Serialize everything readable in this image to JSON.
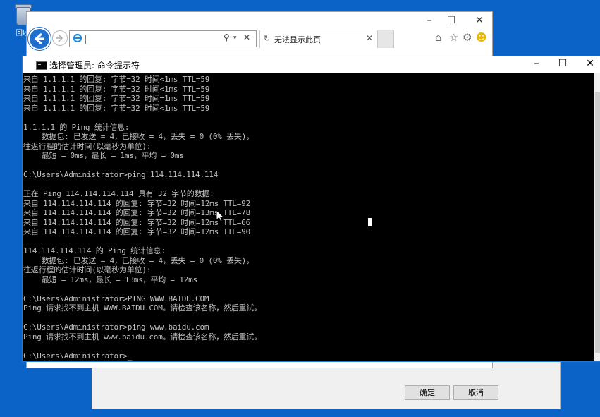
{
  "desktop": {
    "icon_label": "回收"
  },
  "dialog": {
    "ok_label": "确定",
    "cancel_label": "取消"
  },
  "browser": {
    "address_value": "|",
    "tab_title": "无法显示此页"
  },
  "cmd": {
    "title": "选择管理员: 命令提示符",
    "lines": [
      "来自 1.1.1.1 的回复: 字节=32 时间<1ms TTL=59",
      "来自 1.1.1.1 的回复: 字节=32 时间<1ms TTL=59",
      "来自 1.1.1.1 的回复: 字节=32 时间=1ms TTL=59",
      "来自 1.1.1.1 的回复: 字节=32 时间<1ms TTL=59",
      "",
      "1.1.1.1 的 Ping 统计信息:",
      "    数据包: 已发送 = 4，已接收 = 4，丢失 = 0 (0% 丢失)，",
      "往返行程的估计时间(以毫秒为单位):",
      "    最短 = 0ms，最长 = 1ms，平均 = 0ms",
      "",
      "C:\\Users\\Administrator>ping 114.114.114.114",
      "",
      "正在 Ping 114.114.114.114 具有 32 字节的数据:",
      "来自 114.114.114.114 的回复: 字节=32 时间=12ms TTL=92",
      "来自 114.114.114.114 的回复: 字节=32 时间=13ms TTL=78",
      "来自 114.114.114.114 的回复: 字节=32 时间=12ms TTL=66",
      "来自 114.114.114.114 的回复: 字节=32 时间=12ms TTL=90",
      "",
      "114.114.114.114 的 Ping 统计信息:",
      "    数据包: 已发送 = 4，已接收 = 4，丢失 = 0 (0% 丢失)，",
      "往返行程的估计时间(以毫秒为单位):",
      "    最短 = 12ms，最长 = 13ms，平均 = 12ms",
      "",
      "C:\\Users\\Administrator>PING WWW.BAIDU.COM",
      "Ping 请求找不到主机 WWW.BAIDU.COM。请检查该名称，然后重试。",
      "",
      "C:\\Users\\Administrator>ping www.baidu.com",
      "Ping 请求找不到主机 www.baidu.com。请检查该名称，然后重试。",
      "",
      "C:\\Users\\Administrator>_"
    ]
  },
  "icons": {
    "back": "arrow-left-icon",
    "forward": "arrow-right-icon",
    "search": "search-icon",
    "home": "home-icon",
    "favorites": "star-icon",
    "settings": "gear-icon",
    "feedback": "smiley-icon"
  }
}
